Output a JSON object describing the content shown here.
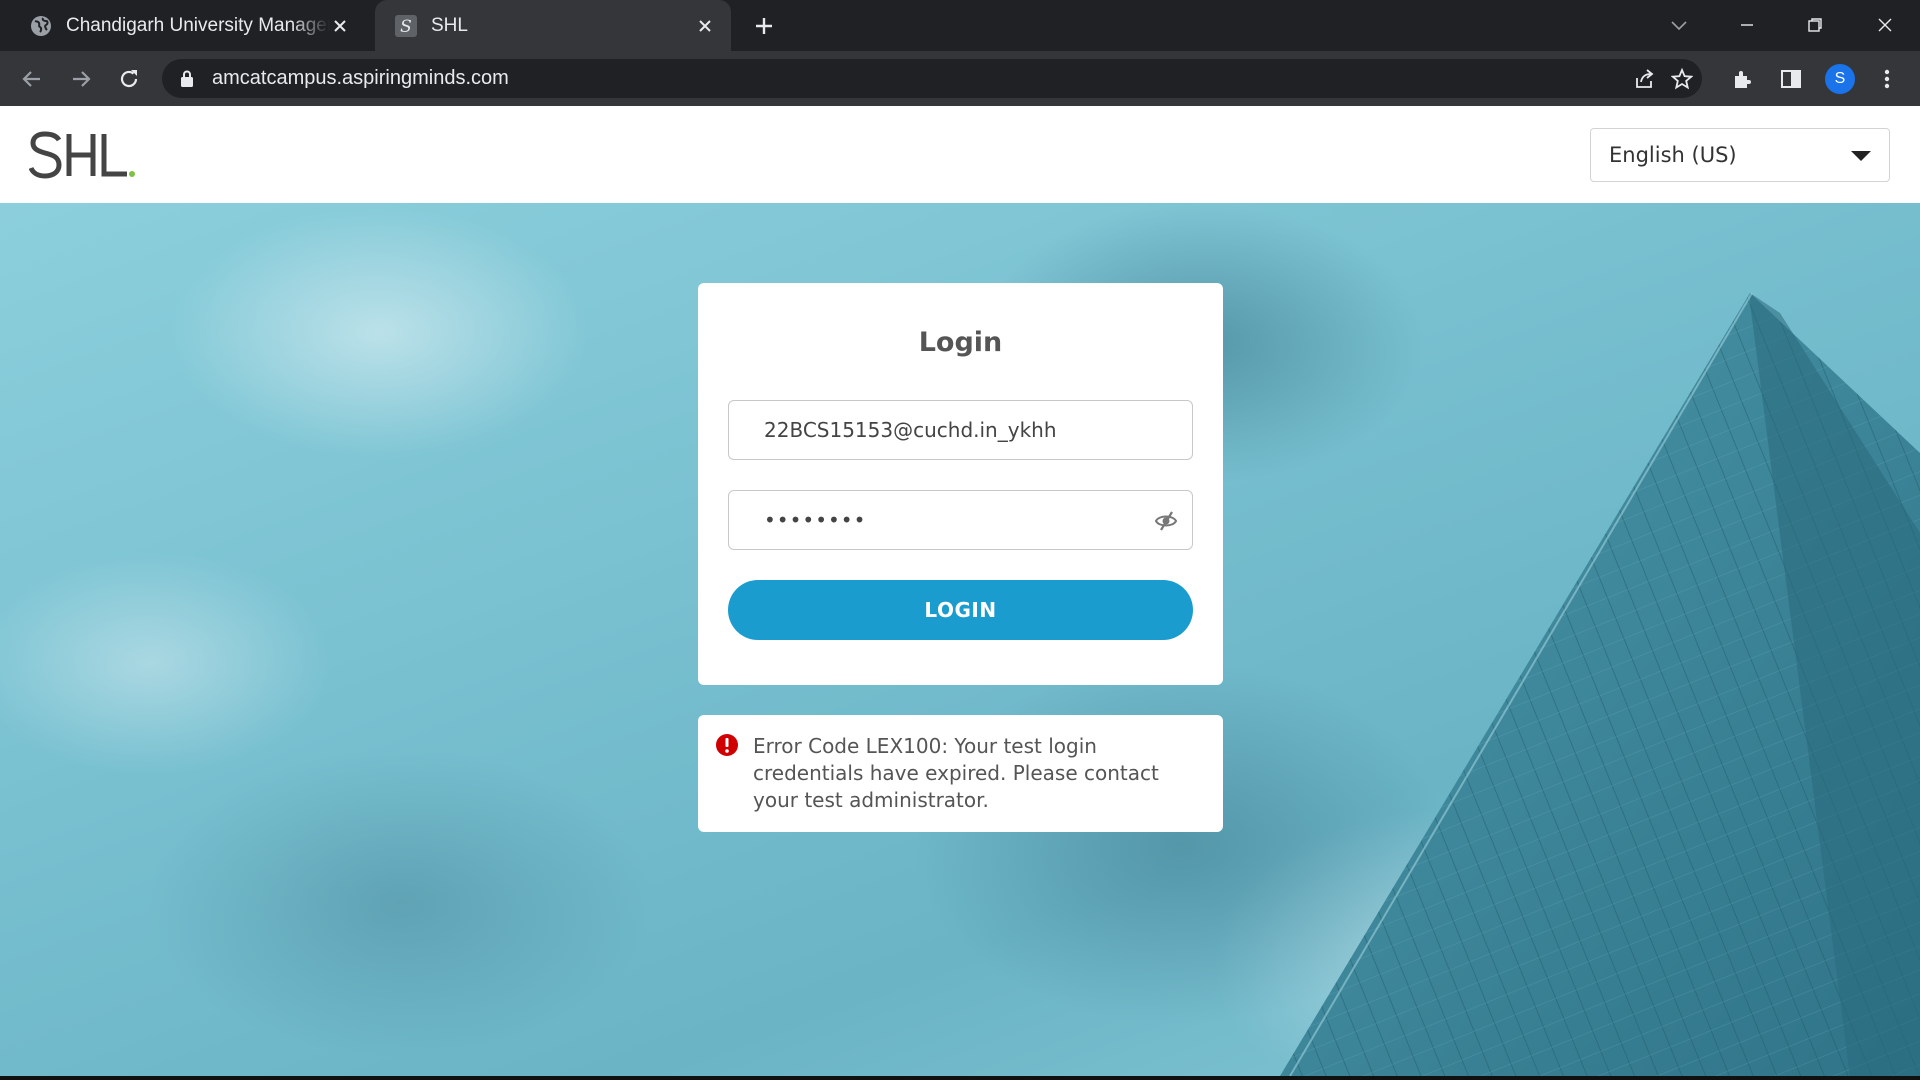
{
  "browser": {
    "tabs": [
      {
        "title": "Chandigarh University Management",
        "icon": "globe-icon",
        "active": false
      },
      {
        "title": "SHL",
        "icon": "shl-favicon",
        "active": true
      }
    ],
    "url": "amcatcampus.aspiringminds.com",
    "profile_initial": "S"
  },
  "header": {
    "logo_text": "SHL",
    "language": {
      "selected": "English (US)"
    }
  },
  "login": {
    "title": "Login",
    "username_value": "22BCS15153@cuchd.in_ykhh",
    "password_value": "••••••••",
    "button_label": "LOGIN"
  },
  "error": {
    "icon": "error-icon",
    "message": "Error Code LEX100: Your test login credentials have expired. Please contact your test administrator."
  },
  "colors": {
    "accent": "#1a9ccf",
    "error": "#d00000",
    "logo_dot": "#7dc243"
  }
}
